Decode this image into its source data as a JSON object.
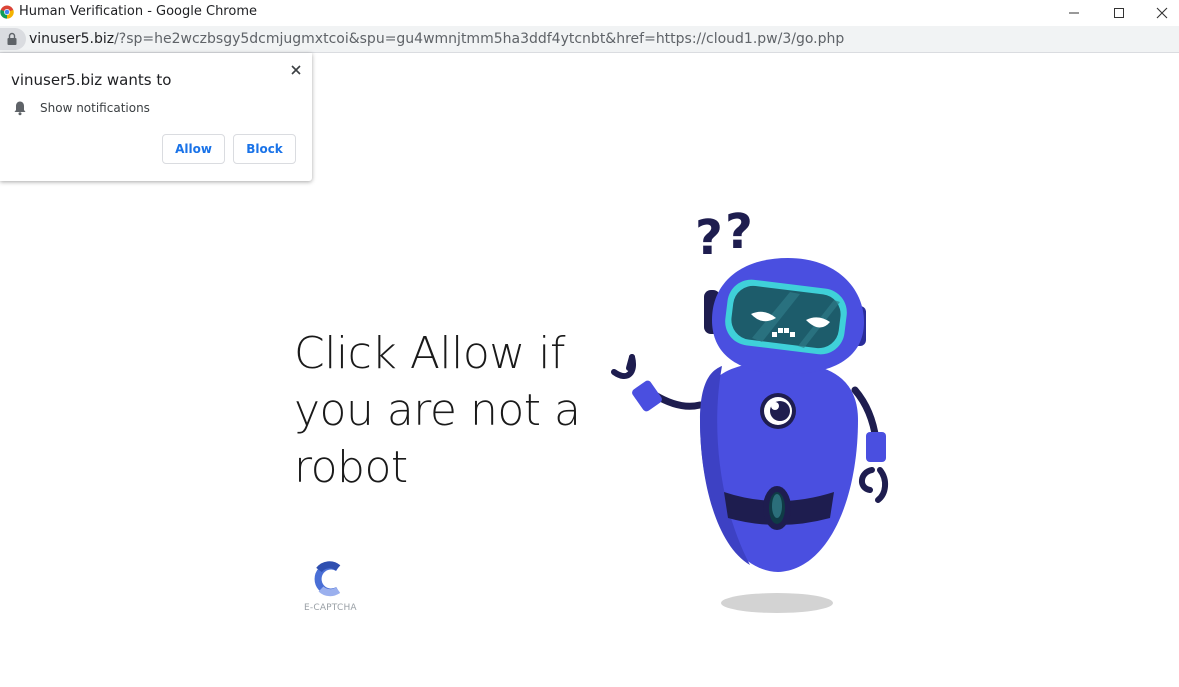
{
  "window": {
    "title": "Human Verification - Google Chrome"
  },
  "address_bar": {
    "host": "vinuser5.biz",
    "path": "/?sp=he2wczbsgy5dcmjugmxtcoi&spu=gu4wmnjtmm5ha3ddf4ytcnbt&href=https://cloud1.pw/3/go.php"
  },
  "permission_popup": {
    "title": "vinuser5.biz wants to",
    "request": "Show notifications",
    "allow_label": "Allow",
    "block_label": "Block"
  },
  "page": {
    "headline": "Click Allow if you are not a robot",
    "captcha_brand": "E-CAPTCHA"
  },
  "icons": {
    "browser": "chrome-icon",
    "lock": "lock-icon",
    "close": "close-icon",
    "bell": "bell-icon",
    "minimize": "minimize-icon",
    "maximize": "maximize-icon"
  },
  "colors": {
    "robot_body": "#4a4fe0",
    "robot_dark": "#1e1d4f",
    "visor": "#1d5c6b",
    "visor_rim": "#3fd0d9",
    "link_blue": "#1a73e8"
  }
}
